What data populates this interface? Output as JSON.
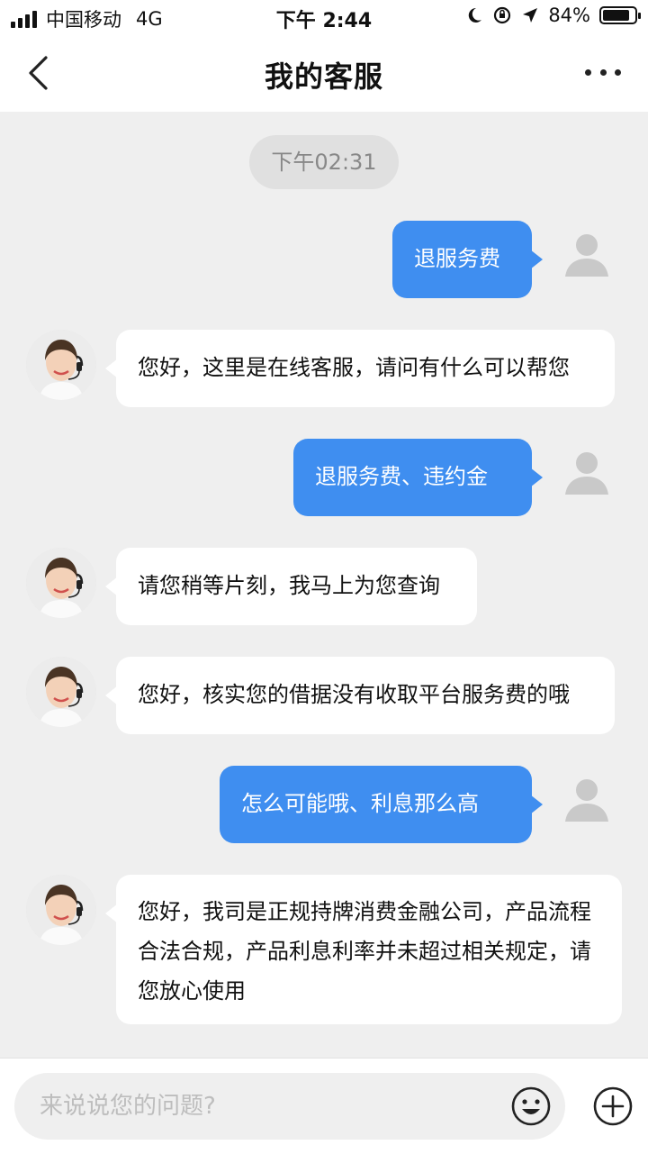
{
  "status_bar": {
    "carrier": "中国移动",
    "network": "4G",
    "time": "下午 2:44",
    "battery": "84%",
    "battery_level": 0.84
  },
  "header": {
    "title": "我的客服"
  },
  "chat": {
    "timestamp": "下午02:31",
    "messages": [
      {
        "from": "user",
        "text": "退服务费"
      },
      {
        "from": "agent",
        "text": "您好，这里是在线客服，请问有什么可以帮您"
      },
      {
        "from": "user",
        "text": "退服务费、违约金"
      },
      {
        "from": "agent",
        "text": "请您稍等片刻，我马上为您查询"
      },
      {
        "from": "agent",
        "text": "您好，核实您的借据没有收取平台服务费的哦"
      },
      {
        "from": "user",
        "text": "怎么可能哦、利息那么高"
      },
      {
        "from": "agent",
        "text": "您好，我司是正规持牌消费金融公司，产品流程合法合规，产品利息利率并未超过相关规定，请您放心使用"
      }
    ]
  },
  "input_bar": {
    "placeholder": "来说说您的问题?"
  },
  "colors": {
    "accent": "#3f8ef0",
    "background": "#efefef"
  }
}
